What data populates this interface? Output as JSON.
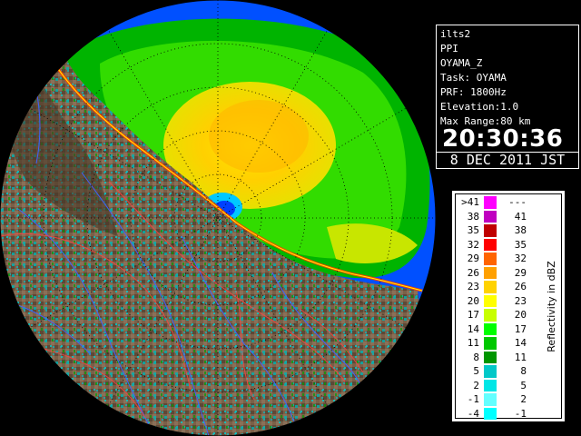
{
  "info": {
    "site": "ilts2",
    "product": "PPI",
    "radar": "OYAMA_Z",
    "task": "Task: OYAMA",
    "prf": "PRF: 1800Hz",
    "elevation": "Elevation:1.0",
    "max_range": "Max Range:80 km",
    "time": "20:30:36",
    "date": "8 DEC 2011 JST"
  },
  "legend": {
    "title": "Reflectivity in dBZ",
    "rows": [
      {
        "lo": ">41",
        "hi": "---",
        "color": "#ff00ff"
      },
      {
        "lo": "38",
        "hi": "41",
        "color": "#c000c0"
      },
      {
        "lo": "35",
        "hi": "38",
        "color": "#c00000"
      },
      {
        "lo": "32",
        "hi": "35",
        "color": "#ff0000"
      },
      {
        "lo": "29",
        "hi": "32",
        "color": "#ff6400"
      },
      {
        "lo": "26",
        "hi": "29",
        "color": "#ffa000"
      },
      {
        "lo": "23",
        "hi": "26",
        "color": "#ffd200"
      },
      {
        "lo": "20",
        "hi": "23",
        "color": "#ffff00"
      },
      {
        "lo": "17",
        "hi": "20",
        "color": "#c8ff00"
      },
      {
        "lo": "14",
        "hi": "17",
        "color": "#00ff00"
      },
      {
        "lo": "11",
        "hi": "14",
        "color": "#00c800"
      },
      {
        "lo": "8",
        "hi": "11",
        "color": "#009600"
      },
      {
        "lo": "5",
        "hi": "8",
        "color": "#00c8c8"
      },
      {
        "lo": "2",
        "hi": "5",
        "color": "#00e6e6"
      },
      {
        "lo": "-1",
        "hi": "2",
        "color": "#64ffff"
      },
      {
        "lo": "-4",
        "hi": "-1",
        "color": "#00ffff"
      }
    ]
  },
  "colors": {
    "outside": "#000000",
    "sea_weak": "#0050ff",
    "sea_mid": "#00a0ff",
    "land": "#7a6048",
    "land_dark": "#4a3828",
    "rivers": "#4060ff",
    "borders": "#ff4040"
  }
}
